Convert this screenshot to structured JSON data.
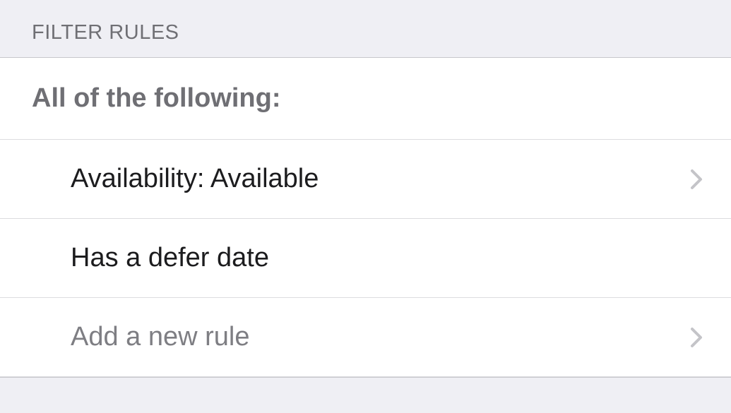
{
  "section": {
    "header": "FILTER RULES",
    "group_label": "All of the following:",
    "rules": [
      {
        "label": "Availability: Available",
        "has_chevron": true,
        "muted": false
      },
      {
        "label": "Has a defer date",
        "has_chevron": false,
        "muted": false
      }
    ],
    "add_rule_label": "Add a new rule"
  }
}
